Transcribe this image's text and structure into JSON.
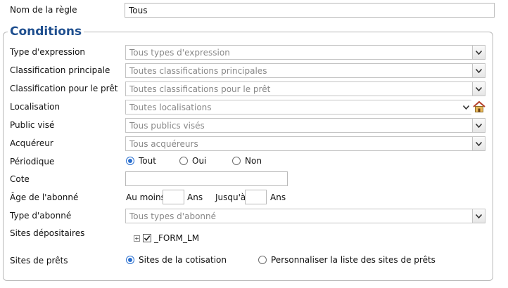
{
  "rule_name": {
    "label": "Nom de la règle",
    "value": "Tous"
  },
  "conditions": {
    "legend": "Conditions",
    "expression_type": {
      "label": "Type d'expression",
      "value": "Tous types d'expression"
    },
    "main_classification": {
      "label": "Classification principale",
      "value": "Toutes classifications principales"
    },
    "loan_classification": {
      "label": "Classification pour le prêt",
      "value": "Toutes classifications pour le prêt"
    },
    "location": {
      "label": "Localisation",
      "value": "Toutes localisations"
    },
    "audience": {
      "label": "Public visé",
      "value": "Tous publics visés"
    },
    "acquirer": {
      "label": "Acquéreur",
      "value": "Tous acquéreurs"
    },
    "periodical": {
      "label": "Périodique",
      "options": [
        "Tout",
        "Oui",
        "Non"
      ],
      "selected": "Tout"
    },
    "cote": {
      "label": "Cote",
      "value": ""
    },
    "subscriber_age": {
      "label": "Âge de l'abonné",
      "min_label": "Au moins",
      "max_label": "Jusqu'à",
      "unit": "Ans",
      "min_value": "",
      "max_value": ""
    },
    "subscriber_type": {
      "label": "Type d'abonné",
      "value": "Tous types d'abonné"
    },
    "depository_sites": {
      "label": "Sites dépositaires",
      "expander": "+",
      "item": "_FORM_LM",
      "checked": true
    },
    "loan_sites": {
      "label": "Sites de prêts",
      "options": [
        "Sites de la cotisation",
        "Personnaliser la liste des sites de prêts"
      ],
      "selected": "Sites de la cotisation"
    }
  }
}
